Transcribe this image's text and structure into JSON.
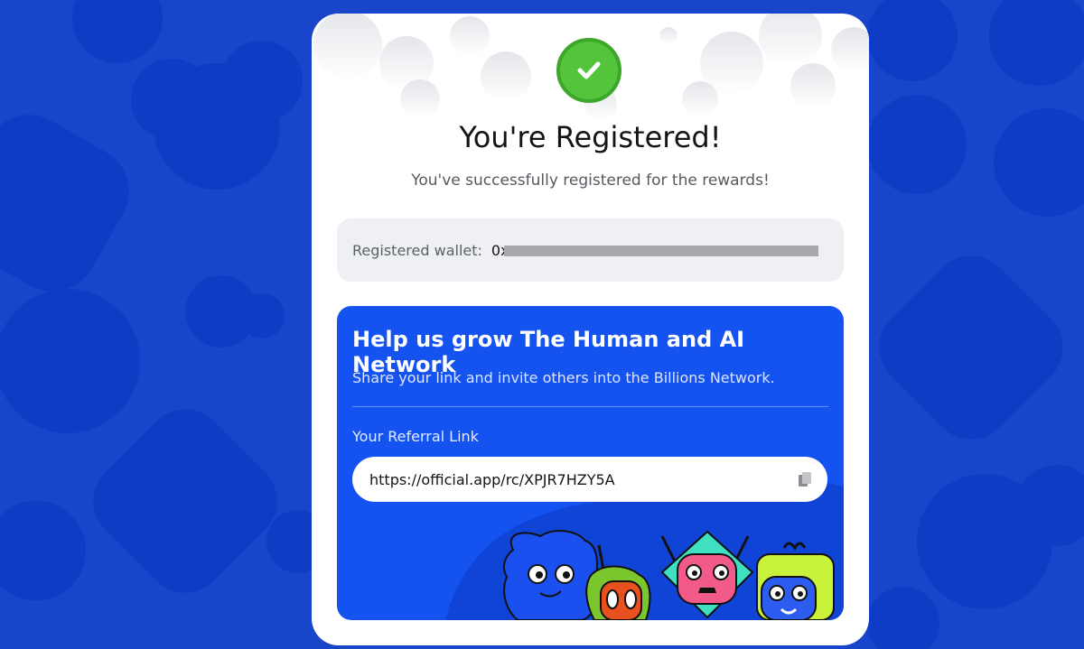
{
  "card": {
    "title": "You're Registered!",
    "subtitle": "You've successfully registered for the rewards!"
  },
  "wallet": {
    "label": "Registered wallet:",
    "value": "0x"
  },
  "promo": {
    "title": "Help us grow The Human and AI Network",
    "description": "Share your link and invite others into the Billions Network.",
    "referral_label": "Your Referral Link",
    "referral_link": "https://official.app/rc/XPJR7HZY5A"
  },
  "icons": {
    "success": "check-circle-icon",
    "copy": "copy-icon"
  },
  "colors": {
    "background": "#1845c9",
    "promo": "#1553f0",
    "success": "#54c43a"
  }
}
